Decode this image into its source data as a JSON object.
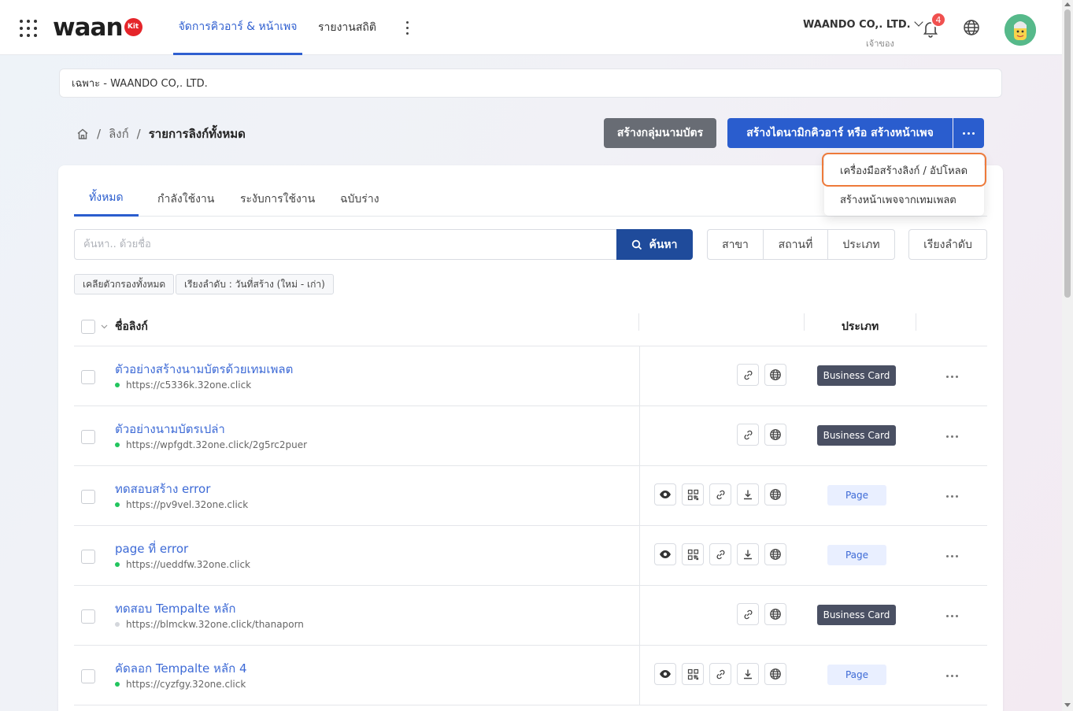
{
  "header": {
    "logo_text": "waan",
    "logo_badge": "Kit",
    "nav_tabs": [
      {
        "label": "จัดการคิวอาร์ & หน้าเพจ",
        "active": true
      },
      {
        "label": "รายงานสถิติ",
        "active": false
      }
    ],
    "company_name": "WAANDO CO,. LTD.",
    "role": "เจ้าของ",
    "notification_count": "4"
  },
  "scope": {
    "text": "เฉพาะ - WAANDO CO,. LTD."
  },
  "breadcrumb": {
    "items": [
      "ลิงก์"
    ],
    "current": "รายการลิงก์ทั้งหมด"
  },
  "actions": {
    "create_group": "สร้างกลุ่มนามบัตร",
    "create_main": "สร้างไดนามิกคิวอาร์ หรือ สร้างหน้าเพจ"
  },
  "dropdown": {
    "items": [
      "เครื่องมือสร้างลิงก์ / อัปโหลด",
      "สร้างหน้าเพจจากเทมเพลต"
    ]
  },
  "tabs": [
    {
      "label": "ทั้งหมด",
      "active": true
    },
    {
      "label": "กำลังใช้งาน",
      "active": false
    },
    {
      "label": "ระงับการใช้งาน",
      "active": false
    },
    {
      "label": "ฉบับร่าง",
      "active": false
    }
  ],
  "search": {
    "placeholder": "ค้นหา.. ด้วยชื่อ",
    "button": "ค้นหา"
  },
  "filters": [
    "สาขา",
    "สถานที่",
    "ประเภท"
  ],
  "sort_label": "เรียงลำดับ",
  "chips": [
    "เคลียตัวกรองทั้งหมด",
    "เรียงลำดับ : วันที่สร้าง (ใหม่ - เก่า)"
  ],
  "table": {
    "col_name": "ชื่อลิงก์",
    "col_type": "ประเภท",
    "rows": [
      {
        "title": "ตัวอย่างสร้างนามบัตรด้วยเทมเพลต",
        "url": "https://c5336k.32one.click",
        "active": true,
        "type": "Business Card"
      },
      {
        "title": "ตัวอย่างนามบัตรเปล่า",
        "url": "https://wpfgdt.32one.click/2g5rc2puer",
        "active": true,
        "type": "Business Card"
      },
      {
        "title": "ทดสอบสร้าง error",
        "url": "https://pv9vel.32one.click",
        "active": true,
        "type": "Page"
      },
      {
        "title": "page ที่ error",
        "url": "https://ueddfw.32one.click",
        "active": true,
        "type": "Page"
      },
      {
        "title": "ทดสอบ Tempalte หลัก",
        "url": "https://blmckw.32one.click/thanaporn",
        "active": false,
        "type": "Business Card"
      },
      {
        "title": "คัดลอก Tempalte หลัก 4",
        "url": "https://cyzfgy.32one.click",
        "active": true,
        "type": "Page"
      }
    ]
  },
  "colors": {
    "primary": "#2a5dce",
    "dark_button": "#686c74",
    "search_button": "#1f4b9b",
    "active_dot": "#22c55e",
    "inactive_dot": "#d4d7dc",
    "highlight": "#ee7a3a"
  }
}
